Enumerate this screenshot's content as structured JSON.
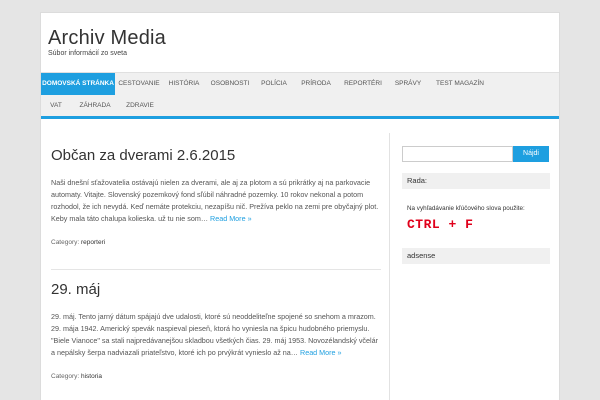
{
  "site": {
    "title": "Archiv Media",
    "description": "Súbor informácií zo sveta"
  },
  "nav": {
    "row1": [
      {
        "label": "DOMOVSKÁ STRÁNKA",
        "active": true
      },
      {
        "label": "CESTOVANIE"
      },
      {
        "label": "HISTÓRIA"
      },
      {
        "label": "OSOBNOSTI"
      },
      {
        "label": "POLÍCIA"
      },
      {
        "label": "PRÍRODA"
      },
      {
        "label": "REPORTÉRI"
      },
      {
        "label": "SPRÁVY"
      },
      {
        "label": "TEST MAGAZÍN"
      }
    ],
    "row2": [
      {
        "label": "VAT"
      },
      {
        "label": "ZÁHRADA"
      },
      {
        "label": "ZDRAVIE"
      }
    ]
  },
  "posts": [
    {
      "title": "Občan za dverami 2.6.2015",
      "excerpt": "Naši dnešní sťažovatelia ostávajú nielen za dverami, ale aj za plotom a sú prikrátky aj na parkovacie automaty. Vitajte. Slovenský pozemkový fond sľúbil náhradné pozemky. 10 rokov nekonal a potom rozhodol, že ich nevydá. Keď nemáte protekciu, nezapíšu nič. Prežíva peklo na zemi pre obyčajný plot. Keby mala táto chalupa kolieska. už tu nie som…",
      "read_more": "Read More »",
      "meta_label": "Category:",
      "category": "reporteri"
    },
    {
      "title": "29. máj",
      "excerpt": "29. máj. Tento jarný dátum spájajú dve udalosti, ktoré sú neoddeliteľne spojené so snehom a mrazom. 29. mája 1942. Americký spevák naspieval pieseň, ktorá ho vyniesla na špicu hudobného priemyslu. \"Biele Vianoce\" sa stali najpredávanejšou skladbou všetkých čias. 29. máj 1953. Novozélandský včelár a nepálsky šerpa nadviazali priateľstvo, ktoré ich po prvýkrát vynieslo až na…",
      "read_more": "Read More »",
      "meta_label": "Category:",
      "category": "historia"
    }
  ],
  "sidebar": {
    "search": {
      "placeholder": "",
      "button": "Nájdi"
    },
    "widget1_title": "Rada:",
    "tip_text": "Na vyhľadávanie kľúčového slova použite:",
    "shortcut": "CTRL + F",
    "widget2_title": "adsense"
  },
  "colors": {
    "accent": "#1e9fe0",
    "shortcut": "#e0001b",
    "background": "#e5e5e5"
  }
}
